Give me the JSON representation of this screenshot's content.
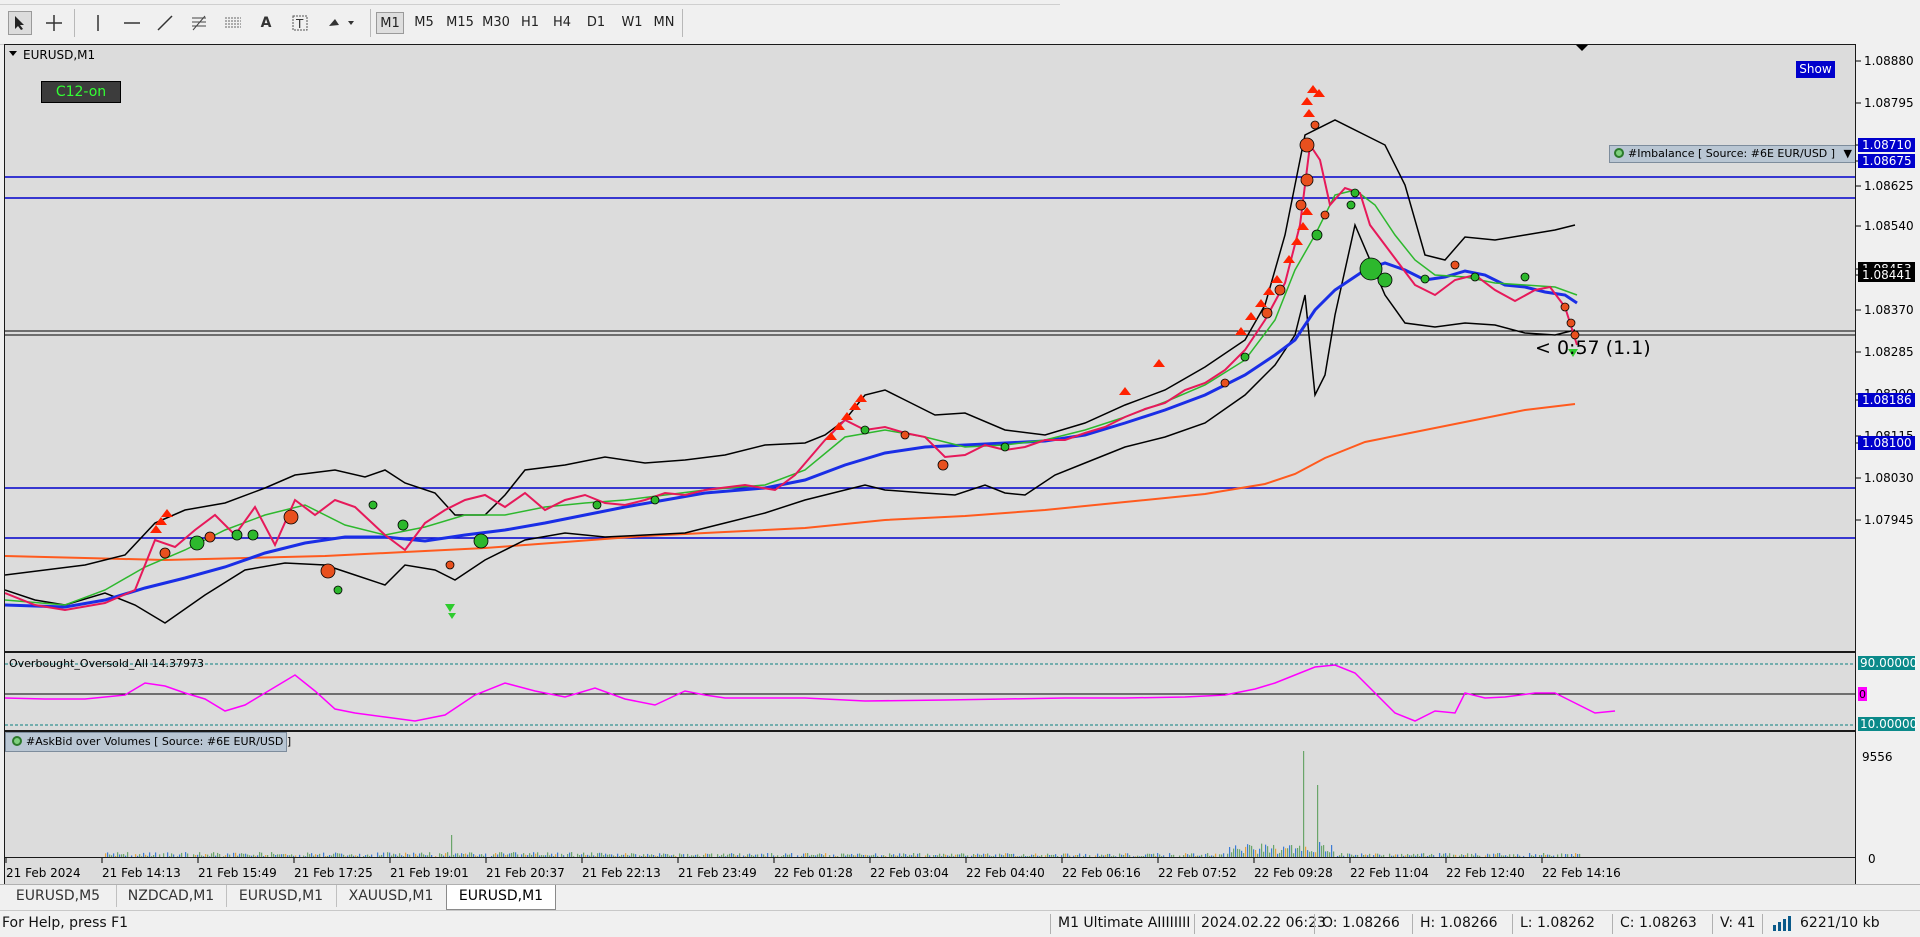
{
  "toolbar": {
    "timeframes": [
      {
        "label": "M1",
        "active": true
      },
      {
        "label": "M5",
        "active": false
      },
      {
        "label": "M15",
        "active": false
      },
      {
        "label": "M30",
        "active": false
      },
      {
        "label": "H1",
        "active": false
      },
      {
        "label": "H4",
        "active": false
      },
      {
        "label": "D1",
        "active": false
      },
      {
        "label": "W1",
        "active": false
      },
      {
        "label": "MN",
        "active": false
      }
    ],
    "tools": [
      "cursor-icon",
      "crosshair-icon",
      "vertical-line-icon",
      "horizontal-line-icon",
      "trendline-icon",
      "fibonacci-icon",
      "channel-icon",
      "text-icon",
      "text-label-icon",
      "shapes-icon"
    ]
  },
  "chart": {
    "symbol_title": "EURUSD,M1",
    "c12_button": "C12-on",
    "show_button": "Show",
    "imbalance_label": "#Imbalance [ Source: #6E EUR/USD ]",
    "annotation": "< 0:57 (1.1)",
    "price_axis": [
      "1.08880",
      "1.08795",
      "1.08710",
      "1.08675",
      "1.08625",
      "1.08540",
      "1.08453",
      "1.08441",
      "1.08370",
      "1.08285",
      "1.08200",
      "1.08186",
      "1.08115",
      "1.08100",
      "1.08030",
      "1.07945"
    ],
    "highlighted_prices": [
      "1.08710",
      "1.08675",
      "1.08186",
      "1.08100"
    ],
    "current_prices": [
      "1.08453",
      "1.08441"
    ],
    "time_axis": [
      "21 Feb 2024",
      "21 Feb 14:13",
      "21 Feb 15:49",
      "21 Feb 17:25",
      "21 Feb 19:01",
      "21 Feb 20:37",
      "21 Feb 22:13",
      "21 Feb 23:49",
      "22 Feb 01:28",
      "22 Feb 03:04",
      "22 Feb 04:40",
      "22 Feb 06:16",
      "22 Feb 07:52",
      "22 Feb 09:28",
      "22 Feb 11:04",
      "22 Feb 12:40",
      "22 Feb 14:16"
    ],
    "colors": {
      "bg": "#dcdcdc",
      "level": "#0000cc",
      "ma_blue": "#1a2ee6",
      "ma_orange": "#ff5a1e",
      "boll": "#000000",
      "fast": "#e6195a",
      "osc": "#ff00ff",
      "bull": "#2db82d",
      "bear": "#e8501e"
    }
  },
  "oscillator": {
    "title": "Overbought_Oversold_All 14.37973",
    "levels": [
      "90.00000",
      "10.00000"
    ],
    "mid_marker": "0"
  },
  "volume": {
    "title": "#AskBid over Volumes [ Source: #6E EUR/USD ]",
    "scale_max": "9556",
    "scale_min": "0"
  },
  "tabs": [
    {
      "label": "EURUSD,M5",
      "active": false
    },
    {
      "label": "NZDCAD,M1",
      "active": false
    },
    {
      "label": "EURUSD,M1",
      "active": false
    },
    {
      "label": "XAUUSD,M1",
      "active": false
    },
    {
      "label": "EURUSD,M1",
      "active": true
    }
  ],
  "status": {
    "help": "For Help, press F1",
    "profile": "M1 Ultimate AIIIIIIII",
    "datetime": "2024.02.22 06:23",
    "open": "O: 1.08266",
    "high": "H: 1.08266",
    "low": "L: 1.08262",
    "close": "C: 1.08263",
    "volume": "V: 41",
    "traffic": "6221/10 kb"
  }
}
